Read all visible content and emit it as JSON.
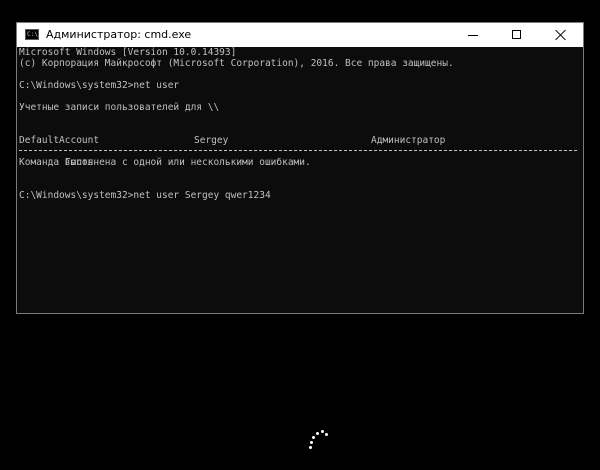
{
  "window": {
    "title": "Администратор: cmd.exe",
    "icon": "cmd-icon",
    "icon_prompt": "C:\\"
  },
  "caption_buttons": {
    "minimize_icon": "minimize-icon",
    "maximize_icon": "maximize-icon",
    "close_icon": "close-icon"
  },
  "console": {
    "text_color": "#c0c0c0",
    "background": "#0c0c0c",
    "lines": {
      "version": "Microsoft Windows [Version 10.0.14393]",
      "copyright": "(c) Корпорация Майкрософт (Microsoft Corporation), 2016. Все права защищены.",
      "command1": "C:\\Windows\\system32>net user",
      "accounts_header": "Учетные записи пользователей для \\\\",
      "accounts_row1": {
        "col1": "DefaultAccount",
        "col2": "Sergey",
        "col3": "Администратор"
      },
      "accounts_row2": {
        "col1": "Гость"
      },
      "result": "Команда выполнена с одной или несколькими ошибками.",
      "command2": "C:\\Windows\\system32>net user Sergey qwer1234"
    }
  },
  "spinner": {
    "icon": "loading-spinner-icon",
    "color": "#ffffff"
  }
}
